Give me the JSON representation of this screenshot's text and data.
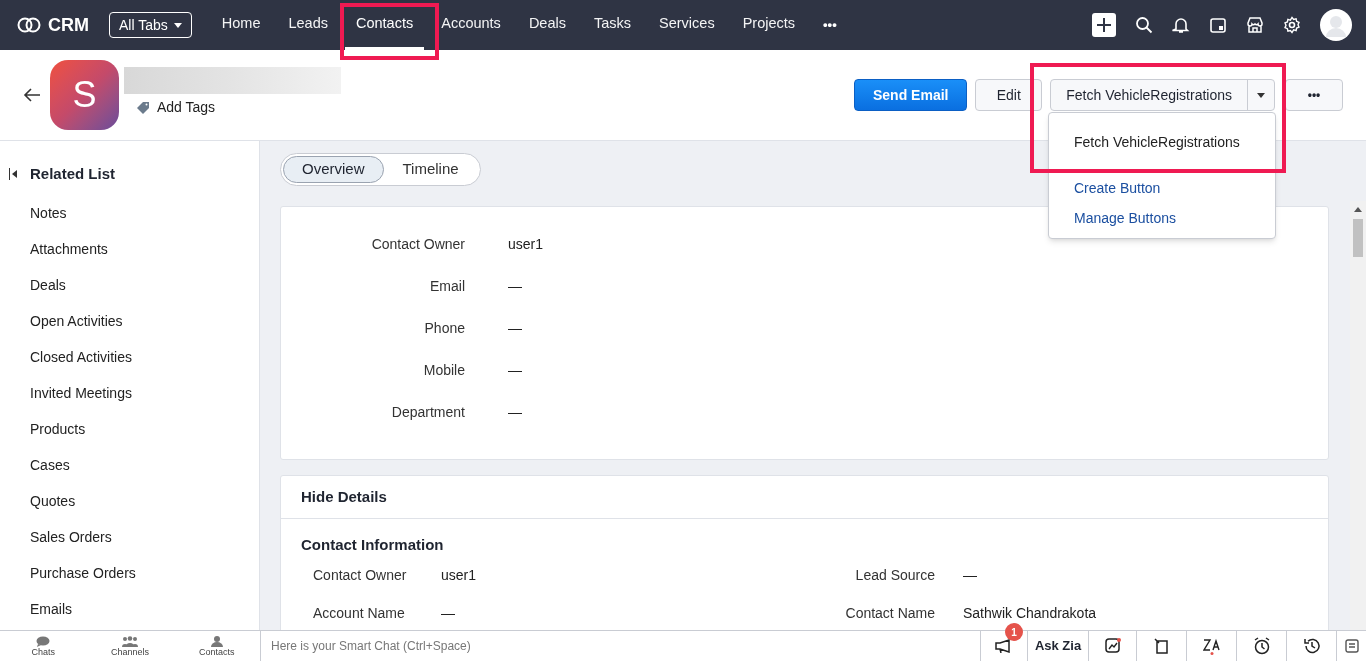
{
  "app": {
    "logo": "CRM",
    "all_tabs": "All Tabs"
  },
  "nav_tabs": [
    {
      "label": "Home",
      "selected": false
    },
    {
      "label": "Leads",
      "selected": false
    },
    {
      "label": "Contacts",
      "selected": true
    },
    {
      "label": "Accounts",
      "selected": false
    },
    {
      "label": "Deals",
      "selected": false
    },
    {
      "label": "Tasks",
      "selected": false
    },
    {
      "label": "Services",
      "selected": false
    },
    {
      "label": "Projects",
      "selected": false
    }
  ],
  "more_tabs": "•••",
  "record": {
    "avatar_letter": "S",
    "add_tags": "Add Tags"
  },
  "actions": {
    "send_email": "Send Email",
    "edit": "Edit",
    "custom_button": "Fetch VehicleRegistrations",
    "more": "•••"
  },
  "dropdown": {
    "items": [
      {
        "label": "Fetch VehicleRegistrations",
        "kind": "action"
      },
      {
        "label": "Create Button",
        "kind": "link"
      },
      {
        "label": "Manage Buttons",
        "kind": "link"
      }
    ]
  },
  "related_list": {
    "title": "Related List",
    "items": [
      "Notes",
      "Attachments",
      "Deals",
      "Open Activities",
      "Closed Activities",
      "Invited Meetings",
      "Products",
      "Cases",
      "Quotes",
      "Sales Orders",
      "Purchase Orders",
      "Emails"
    ]
  },
  "view_tabs": [
    {
      "label": "Overview",
      "selected": true
    },
    {
      "label": "Timeline",
      "selected": false
    }
  ],
  "overview_fields": [
    {
      "label": "Contact Owner",
      "value": "user1"
    },
    {
      "label": "Email",
      "value": "—"
    },
    {
      "label": "Phone",
      "value": "—"
    },
    {
      "label": "Mobile",
      "value": "—"
    },
    {
      "label": "Department",
      "value": "—"
    }
  ],
  "details": {
    "toggle": "Hide Details",
    "section": "Contact Information",
    "left": [
      {
        "label": "Contact Owner",
        "value": "user1"
      },
      {
        "label": "Account Name",
        "value": "—"
      }
    ],
    "right": [
      {
        "label": "Lead Source",
        "value": "—"
      },
      {
        "label": "Contact Name",
        "value": "Sathwik Chandrakota"
      }
    ]
  },
  "bottom_bar": {
    "tabs": [
      {
        "label": "Chats",
        "kind": "chat"
      },
      {
        "label": "Channels",
        "kind": "channels"
      },
      {
        "label": "Contacts",
        "kind": "contacts"
      }
    ],
    "smart_chat_placeholder": "Here is your Smart Chat (Ctrl+Space)",
    "notification_count": "1",
    "ask_zia": "Ask Zia"
  }
}
